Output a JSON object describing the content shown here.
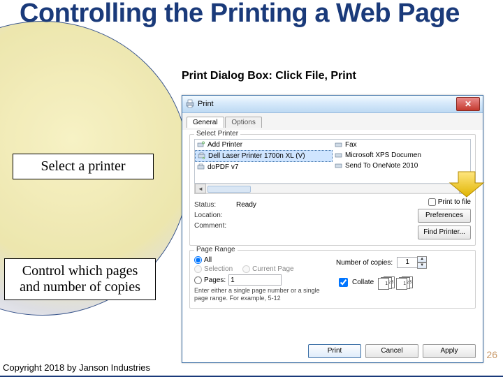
{
  "slide": {
    "title": "Controlling the Printing a Web Page",
    "caption": "Print Dialog Box: Click File, Print",
    "callouts": [
      "Select a printer",
      "Control which pages and number of copies"
    ],
    "page_number": "26",
    "copyright": "Copyright 2018 by Janson Industries"
  },
  "dialog": {
    "title": "Print",
    "tabs": [
      "General",
      "Options"
    ],
    "select_printer": {
      "title": "Select Printer",
      "items": [
        "Add Printer",
        "Dell Laser Printer 1700n XL (V)",
        "doPDF v7",
        "Fax",
        "Microsoft XPS Documen",
        "Send To OneNote 2010"
      ],
      "status_label": "Status:",
      "status_value": "Ready",
      "location_label": "Location:",
      "location_value": "",
      "comment_label": "Comment:",
      "comment_value": "",
      "print_to_file": "Print to file",
      "preferences": "Preferences",
      "find_printer": "Find Printer..."
    },
    "page_range": {
      "title": "Page Range",
      "all": "All",
      "selection": "Selection",
      "current": "Current Page",
      "pages": "Pages:",
      "pages_value": "1",
      "hint": "Enter either a single page number or a single page range. For example, 5-12",
      "copies_label": "Number of copies:",
      "copies_value": "1",
      "collate": "Collate"
    },
    "footer": {
      "print": "Print",
      "cancel": "Cancel",
      "apply": "Apply"
    }
  }
}
